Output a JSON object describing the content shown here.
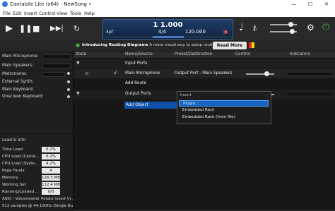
{
  "window": {
    "title": "Cantabile Lite (x64) - NewSong •",
    "minimize": "—",
    "maximize": "☐",
    "close": "✕"
  },
  "menu": [
    "File",
    "Edit",
    "Insert",
    "Control",
    "View",
    "Tools",
    "Help"
  ],
  "transport": {
    "position": "1 1.000",
    "key": "4pf",
    "time_signature": "4/4",
    "tempo": "120.000"
  },
  "notice": {
    "title": "Introducing Routing Diagrams",
    "text": "A more visual way to setup routing",
    "button": "Read More"
  },
  "sidebar": {
    "ports": [
      {
        "label": "Main Microphone:"
      },
      {
        "label": "Main Speakers:"
      },
      {
        "label": "Metronome:"
      },
      {
        "label": "External Synth:"
      },
      {
        "label": "Main Keyboard:"
      },
      {
        "label": "Onscreen Keyboard:"
      }
    ],
    "load_title": "Load & Info",
    "load": [
      {
        "label": "Time Load",
        "value": "0.2%"
      },
      {
        "label": "CPU Load (Canta...",
        "value": "0.2%"
      },
      {
        "label": "CPU Load (Syste...",
        "value": "4.2%"
      },
      {
        "label": "Page Faults",
        "value": "4"
      },
      {
        "label": "Memory",
        "value": "116.5 MB"
      },
      {
        "label": "Working Set",
        "value": "112.4 MB"
      },
      {
        "label": "Running/Loaded...",
        "value": "0/0"
      }
    ],
    "audio_line1": "ASIO - Voicemeeter Potato Insert Vi...",
    "audio_line2": "512 samples @ 44.100Hz (Single Bu..."
  },
  "columns": [
    "State",
    "Name/Source",
    "Preset/Destination",
    "Control",
    "Indicators"
  ],
  "rows": {
    "input_ports": "Input Ports",
    "main_microphone": "Main Microphone",
    "main_microphone_dest": "Output Port - Main Speakers",
    "add_route": "Add Route",
    "output_ports": "Output Ports",
    "add_object": "Add Object"
  },
  "popup": {
    "header": "Insert",
    "items": [
      "Plugin...",
      "Embedded Rack",
      "Embedded Rack (from file)"
    ]
  },
  "colors": {
    "accent": "#1565c0",
    "power": "#3cb043",
    "display": "#1f3c66"
  }
}
